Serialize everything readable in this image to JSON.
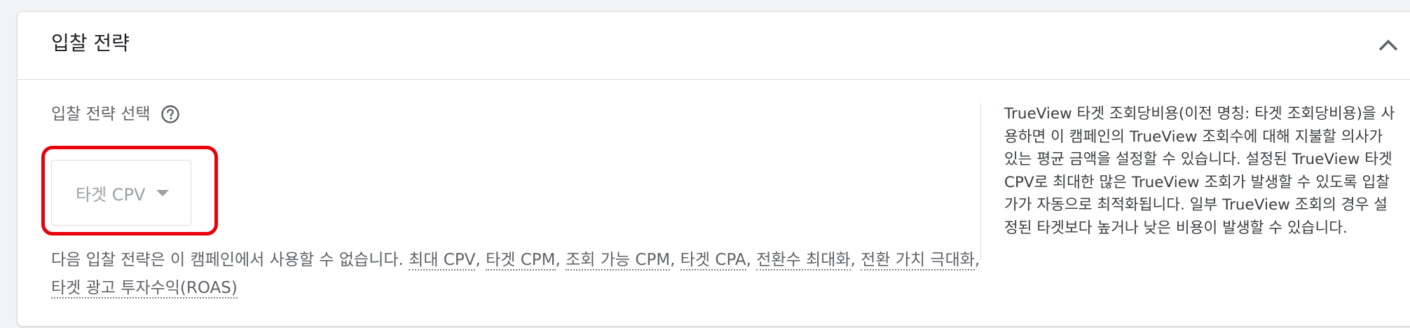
{
  "header": {
    "title": "입찰 전략",
    "collapse_icon": "chevron-up-icon"
  },
  "strategy": {
    "label": "입찰 전략 선택",
    "help_icon": "help-circle-icon",
    "selected_value": "타겟 CPV",
    "caret_icon": "caret-down-icon"
  },
  "unavailable": {
    "prefix": "다음 입찰 전략은 이 캠페인에서 사용할 수 없습니다. ",
    "separator": ", ",
    "items": [
      "최대 CPV",
      "타겟 CPM",
      "조회 가능 CPM",
      "타겟 CPA",
      "전환수 최대화",
      "전환 가치 극대화",
      "타겟 광고 투자수익(ROAS)"
    ]
  },
  "description": {
    "text": "TrueView 타겟 조회당비용(이전 명칭: 타겟 조회당비용)을 사용하면 이 캠페인의 TrueView 조회수에 대해 지불할 의사가 있는 평균 금액을 설정할 수 있습니다. 설정된 TrueView 타겟 CPV로 최대한 많은 TrueView 조회가 발생할 수 있도록 입찰가가 자동으로 최적화됩니다. 일부 TrueView 조회의 경우 설정된 타겟보다 높거나 낮은 비용이 발생할 수 있습니다."
  },
  "colors": {
    "highlight": "#e8000b",
    "text_primary": "#202124",
    "text_secondary": "#5f6368",
    "border": "#dadce0"
  }
}
